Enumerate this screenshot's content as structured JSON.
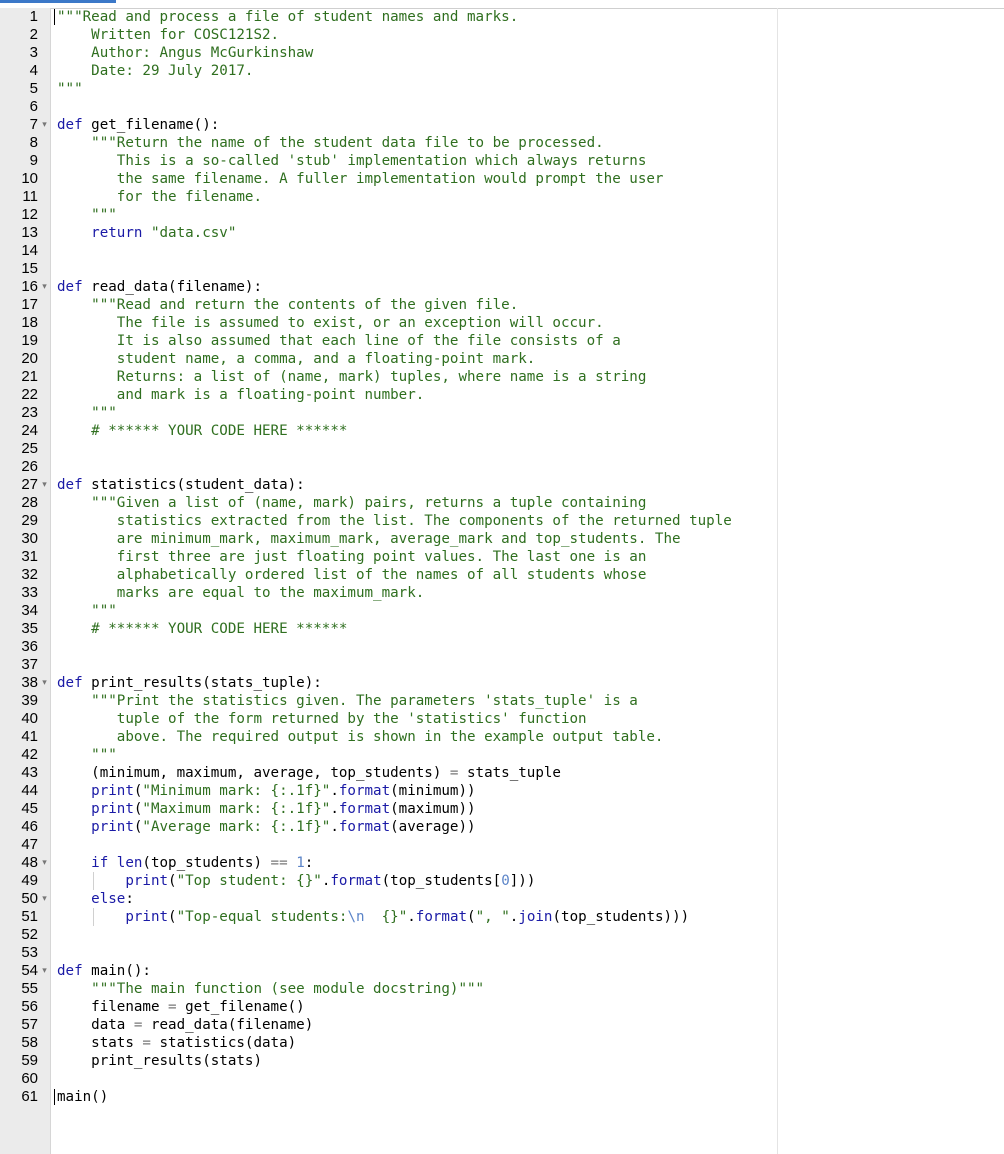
{
  "editor": {
    "language": "python",
    "fold_marker": "▾",
    "lines": [
      {
        "n": "1",
        "fold": false,
        "cursor": true,
        "tokens": [
          {
            "t": "s",
            "v": "\"\"\"Read and process a file of student names and marks."
          }
        ]
      },
      {
        "n": "2",
        "fold": false,
        "tokens": [
          {
            "t": "s",
            "v": "    Written for COSC121S2."
          }
        ]
      },
      {
        "n": "3",
        "fold": false,
        "tokens": [
          {
            "t": "s",
            "v": "    Author: Angus McGurkinshaw"
          }
        ]
      },
      {
        "n": "4",
        "fold": false,
        "tokens": [
          {
            "t": "s",
            "v": "    Date: 29 July 2017."
          }
        ]
      },
      {
        "n": "5",
        "fold": false,
        "tokens": [
          {
            "t": "s",
            "v": "\"\"\""
          }
        ]
      },
      {
        "n": "6",
        "fold": false,
        "tokens": []
      },
      {
        "n": "7",
        "fold": true,
        "tokens": [
          {
            "t": "k",
            "v": "def "
          },
          {
            "t": "n",
            "v": "get_filename():"
          }
        ]
      },
      {
        "n": "8",
        "fold": false,
        "tokens": [
          {
            "t": "s",
            "v": "    \"\"\"Return the name of the student data file to be processed."
          }
        ]
      },
      {
        "n": "9",
        "fold": false,
        "tokens": [
          {
            "t": "s",
            "v": "       This is a so-called 'stub' implementation which always returns"
          }
        ]
      },
      {
        "n": "10",
        "fold": false,
        "tokens": [
          {
            "t": "s",
            "v": "       the same filename. A fuller implementation would prompt the user"
          }
        ]
      },
      {
        "n": "11",
        "fold": false,
        "tokens": [
          {
            "t": "s",
            "v": "       for the filename."
          }
        ]
      },
      {
        "n": "12",
        "fold": false,
        "tokens": [
          {
            "t": "s",
            "v": "    \"\"\""
          }
        ]
      },
      {
        "n": "13",
        "fold": false,
        "tokens": [
          {
            "t": "k",
            "v": "    return "
          },
          {
            "t": "s",
            "v": "\"data.csv\""
          }
        ]
      },
      {
        "n": "14",
        "fold": false,
        "tokens": []
      },
      {
        "n": "15",
        "fold": false,
        "tokens": []
      },
      {
        "n": "16",
        "fold": true,
        "tokens": [
          {
            "t": "k",
            "v": "def "
          },
          {
            "t": "n",
            "v": "read_data(filename):"
          }
        ]
      },
      {
        "n": "17",
        "fold": false,
        "tokens": [
          {
            "t": "s",
            "v": "    \"\"\"Read and return the contents of the given file."
          }
        ]
      },
      {
        "n": "18",
        "fold": false,
        "tokens": [
          {
            "t": "s",
            "v": "       The file is assumed to exist, or an exception will occur."
          }
        ]
      },
      {
        "n": "19",
        "fold": false,
        "tokens": [
          {
            "t": "s",
            "v": "       It is also assumed that each line of the file consists of a"
          }
        ]
      },
      {
        "n": "20",
        "fold": false,
        "tokens": [
          {
            "t": "s",
            "v": "       student name, a comma, and a floating-point mark."
          }
        ]
      },
      {
        "n": "21",
        "fold": false,
        "tokens": [
          {
            "t": "s",
            "v": "       Returns: a list of (name, mark) tuples, where name is a string"
          }
        ]
      },
      {
        "n": "22",
        "fold": false,
        "tokens": [
          {
            "t": "s",
            "v": "       and mark is a floating-point number."
          }
        ]
      },
      {
        "n": "23",
        "fold": false,
        "tokens": [
          {
            "t": "s",
            "v": "    \"\"\""
          }
        ]
      },
      {
        "n": "24",
        "fold": false,
        "tokens": [
          {
            "t": "c",
            "v": "    # ****** YOUR CODE HERE ******"
          }
        ]
      },
      {
        "n": "25",
        "fold": false,
        "tokens": []
      },
      {
        "n": "26",
        "fold": false,
        "tokens": []
      },
      {
        "n": "27",
        "fold": true,
        "tokens": [
          {
            "t": "k",
            "v": "def "
          },
          {
            "t": "n",
            "v": "statistics(student_data):"
          }
        ]
      },
      {
        "n": "28",
        "fold": false,
        "tokens": [
          {
            "t": "s",
            "v": "    \"\"\"Given a list of (name, mark) pairs, returns a tuple containing"
          }
        ]
      },
      {
        "n": "29",
        "fold": false,
        "tokens": [
          {
            "t": "s",
            "v": "       statistics extracted from the list. The components of the returned tuple"
          }
        ]
      },
      {
        "n": "30",
        "fold": false,
        "tokens": [
          {
            "t": "s",
            "v": "       are minimum_mark, maximum_mark, average_mark and top_students. The"
          }
        ]
      },
      {
        "n": "31",
        "fold": false,
        "tokens": [
          {
            "t": "s",
            "v": "       first three are just floating point values. The last one is an"
          }
        ]
      },
      {
        "n": "32",
        "fold": false,
        "tokens": [
          {
            "t": "s",
            "v": "       alphabetically ordered list of the names of all students whose"
          }
        ]
      },
      {
        "n": "33",
        "fold": false,
        "tokens": [
          {
            "t": "s",
            "v": "       marks are equal to the maximum_mark."
          }
        ]
      },
      {
        "n": "34",
        "fold": false,
        "tokens": [
          {
            "t": "s",
            "v": "    \"\"\""
          }
        ]
      },
      {
        "n": "35",
        "fold": false,
        "tokens": [
          {
            "t": "c",
            "v": "    # ****** YOUR CODE HERE ******"
          }
        ]
      },
      {
        "n": "36",
        "fold": false,
        "tokens": []
      },
      {
        "n": "37",
        "fold": false,
        "tokens": []
      },
      {
        "n": "38",
        "fold": true,
        "tokens": [
          {
            "t": "k",
            "v": "def "
          },
          {
            "t": "n",
            "v": "print_results(stats_tuple):"
          }
        ]
      },
      {
        "n": "39",
        "fold": false,
        "tokens": [
          {
            "t": "s",
            "v": "    \"\"\"Print the statistics given. The parameters 'stats_tuple' is a"
          }
        ]
      },
      {
        "n": "40",
        "fold": false,
        "tokens": [
          {
            "t": "s",
            "v": "       tuple of the form returned by the 'statistics' function"
          }
        ]
      },
      {
        "n": "41",
        "fold": false,
        "tokens": [
          {
            "t": "s",
            "v": "       above. The required output is shown in the example output table."
          }
        ]
      },
      {
        "n": "42",
        "fold": false,
        "tokens": [
          {
            "t": "s",
            "v": "    \"\"\""
          }
        ]
      },
      {
        "n": "43",
        "fold": false,
        "tokens": [
          {
            "t": "n",
            "v": "    (minimum, maximum, average, top_students) "
          },
          {
            "t": "op",
            "v": "="
          },
          {
            "t": "n",
            "v": " stats_tuple"
          }
        ]
      },
      {
        "n": "44",
        "fold": false,
        "tokens": [
          {
            "t": "b",
            "v": "    print"
          },
          {
            "t": "n",
            "v": "("
          },
          {
            "t": "s",
            "v": "\"Minimum mark: {:.1f}\""
          },
          {
            "t": "n",
            "v": "."
          },
          {
            "t": "b",
            "v": "format"
          },
          {
            "t": "n",
            "v": "(minimum))"
          }
        ]
      },
      {
        "n": "45",
        "fold": false,
        "tokens": [
          {
            "t": "b",
            "v": "    print"
          },
          {
            "t": "n",
            "v": "("
          },
          {
            "t": "s",
            "v": "\"Maximum mark: {:.1f}\""
          },
          {
            "t": "n",
            "v": "."
          },
          {
            "t": "b",
            "v": "format"
          },
          {
            "t": "n",
            "v": "(maximum))"
          }
        ]
      },
      {
        "n": "46",
        "fold": false,
        "tokens": [
          {
            "t": "b",
            "v": "    print"
          },
          {
            "t": "n",
            "v": "("
          },
          {
            "t": "s",
            "v": "\"Average mark: {:.1f}\""
          },
          {
            "t": "n",
            "v": "."
          },
          {
            "t": "b",
            "v": "format"
          },
          {
            "t": "n",
            "v": "(average))"
          }
        ]
      },
      {
        "n": "47",
        "fold": false,
        "tokens": []
      },
      {
        "n": "48",
        "fold": true,
        "tokens": [
          {
            "t": "k",
            "v": "    if "
          },
          {
            "t": "b",
            "v": "len"
          },
          {
            "t": "n",
            "v": "(top_students) "
          },
          {
            "t": "op",
            "v": "=="
          },
          {
            "t": "n",
            "v": " "
          },
          {
            "t": "bl",
            "v": "1"
          },
          {
            "t": "n",
            "v": ":"
          }
        ]
      },
      {
        "n": "49",
        "fold": false,
        "guide": true,
        "tokens": [
          {
            "t": "b",
            "v": "        print"
          },
          {
            "t": "n",
            "v": "("
          },
          {
            "t": "s",
            "v": "\"Top student: {}\""
          },
          {
            "t": "n",
            "v": "."
          },
          {
            "t": "b",
            "v": "format"
          },
          {
            "t": "n",
            "v": "(top_students["
          },
          {
            "t": "bl",
            "v": "0"
          },
          {
            "t": "n",
            "v": "]))"
          }
        ]
      },
      {
        "n": "50",
        "fold": true,
        "tokens": [
          {
            "t": "k",
            "v": "    else"
          },
          {
            "t": "n",
            "v": ":"
          }
        ]
      },
      {
        "n": "51",
        "fold": false,
        "guide": true,
        "tokens": [
          {
            "t": "b",
            "v": "        print"
          },
          {
            "t": "n",
            "v": "("
          },
          {
            "t": "s",
            "v": "\"Top-equal students:"
          },
          {
            "t": "bl",
            "v": "\\n"
          },
          {
            "t": "s",
            "v": "  {}\""
          },
          {
            "t": "n",
            "v": "."
          },
          {
            "t": "b",
            "v": "format"
          },
          {
            "t": "n",
            "v": "("
          },
          {
            "t": "s",
            "v": "\", \""
          },
          {
            "t": "n",
            "v": "."
          },
          {
            "t": "b",
            "v": "join"
          },
          {
            "t": "n",
            "v": "(top_students)))"
          }
        ]
      },
      {
        "n": "52",
        "fold": false,
        "tokens": []
      },
      {
        "n": "53",
        "fold": false,
        "tokens": []
      },
      {
        "n": "54",
        "fold": true,
        "tokens": [
          {
            "t": "k",
            "v": "def "
          },
          {
            "t": "n",
            "v": "main():"
          }
        ]
      },
      {
        "n": "55",
        "fold": false,
        "tokens": [
          {
            "t": "s",
            "v": "    \"\"\"The main function (see module docstring)\"\"\""
          }
        ]
      },
      {
        "n": "56",
        "fold": false,
        "tokens": [
          {
            "t": "n",
            "v": "    filename "
          },
          {
            "t": "op",
            "v": "="
          },
          {
            "t": "n",
            "v": " get_filename()"
          }
        ]
      },
      {
        "n": "57",
        "fold": false,
        "tokens": [
          {
            "t": "n",
            "v": "    data "
          },
          {
            "t": "op",
            "v": "="
          },
          {
            "t": "n",
            "v": " read_data(filename)"
          }
        ]
      },
      {
        "n": "58",
        "fold": false,
        "tokens": [
          {
            "t": "n",
            "v": "    stats "
          },
          {
            "t": "op",
            "v": "="
          },
          {
            "t": "n",
            "v": " statistics(data)"
          }
        ]
      },
      {
        "n": "59",
        "fold": false,
        "tokens": [
          {
            "t": "n",
            "v": "    print_results(stats)"
          }
        ]
      },
      {
        "n": "60",
        "fold": false,
        "tokens": []
      },
      {
        "n": "61",
        "fold": false,
        "cursor": true,
        "tokens": [
          {
            "t": "n",
            "v": "main()"
          }
        ]
      }
    ]
  }
}
